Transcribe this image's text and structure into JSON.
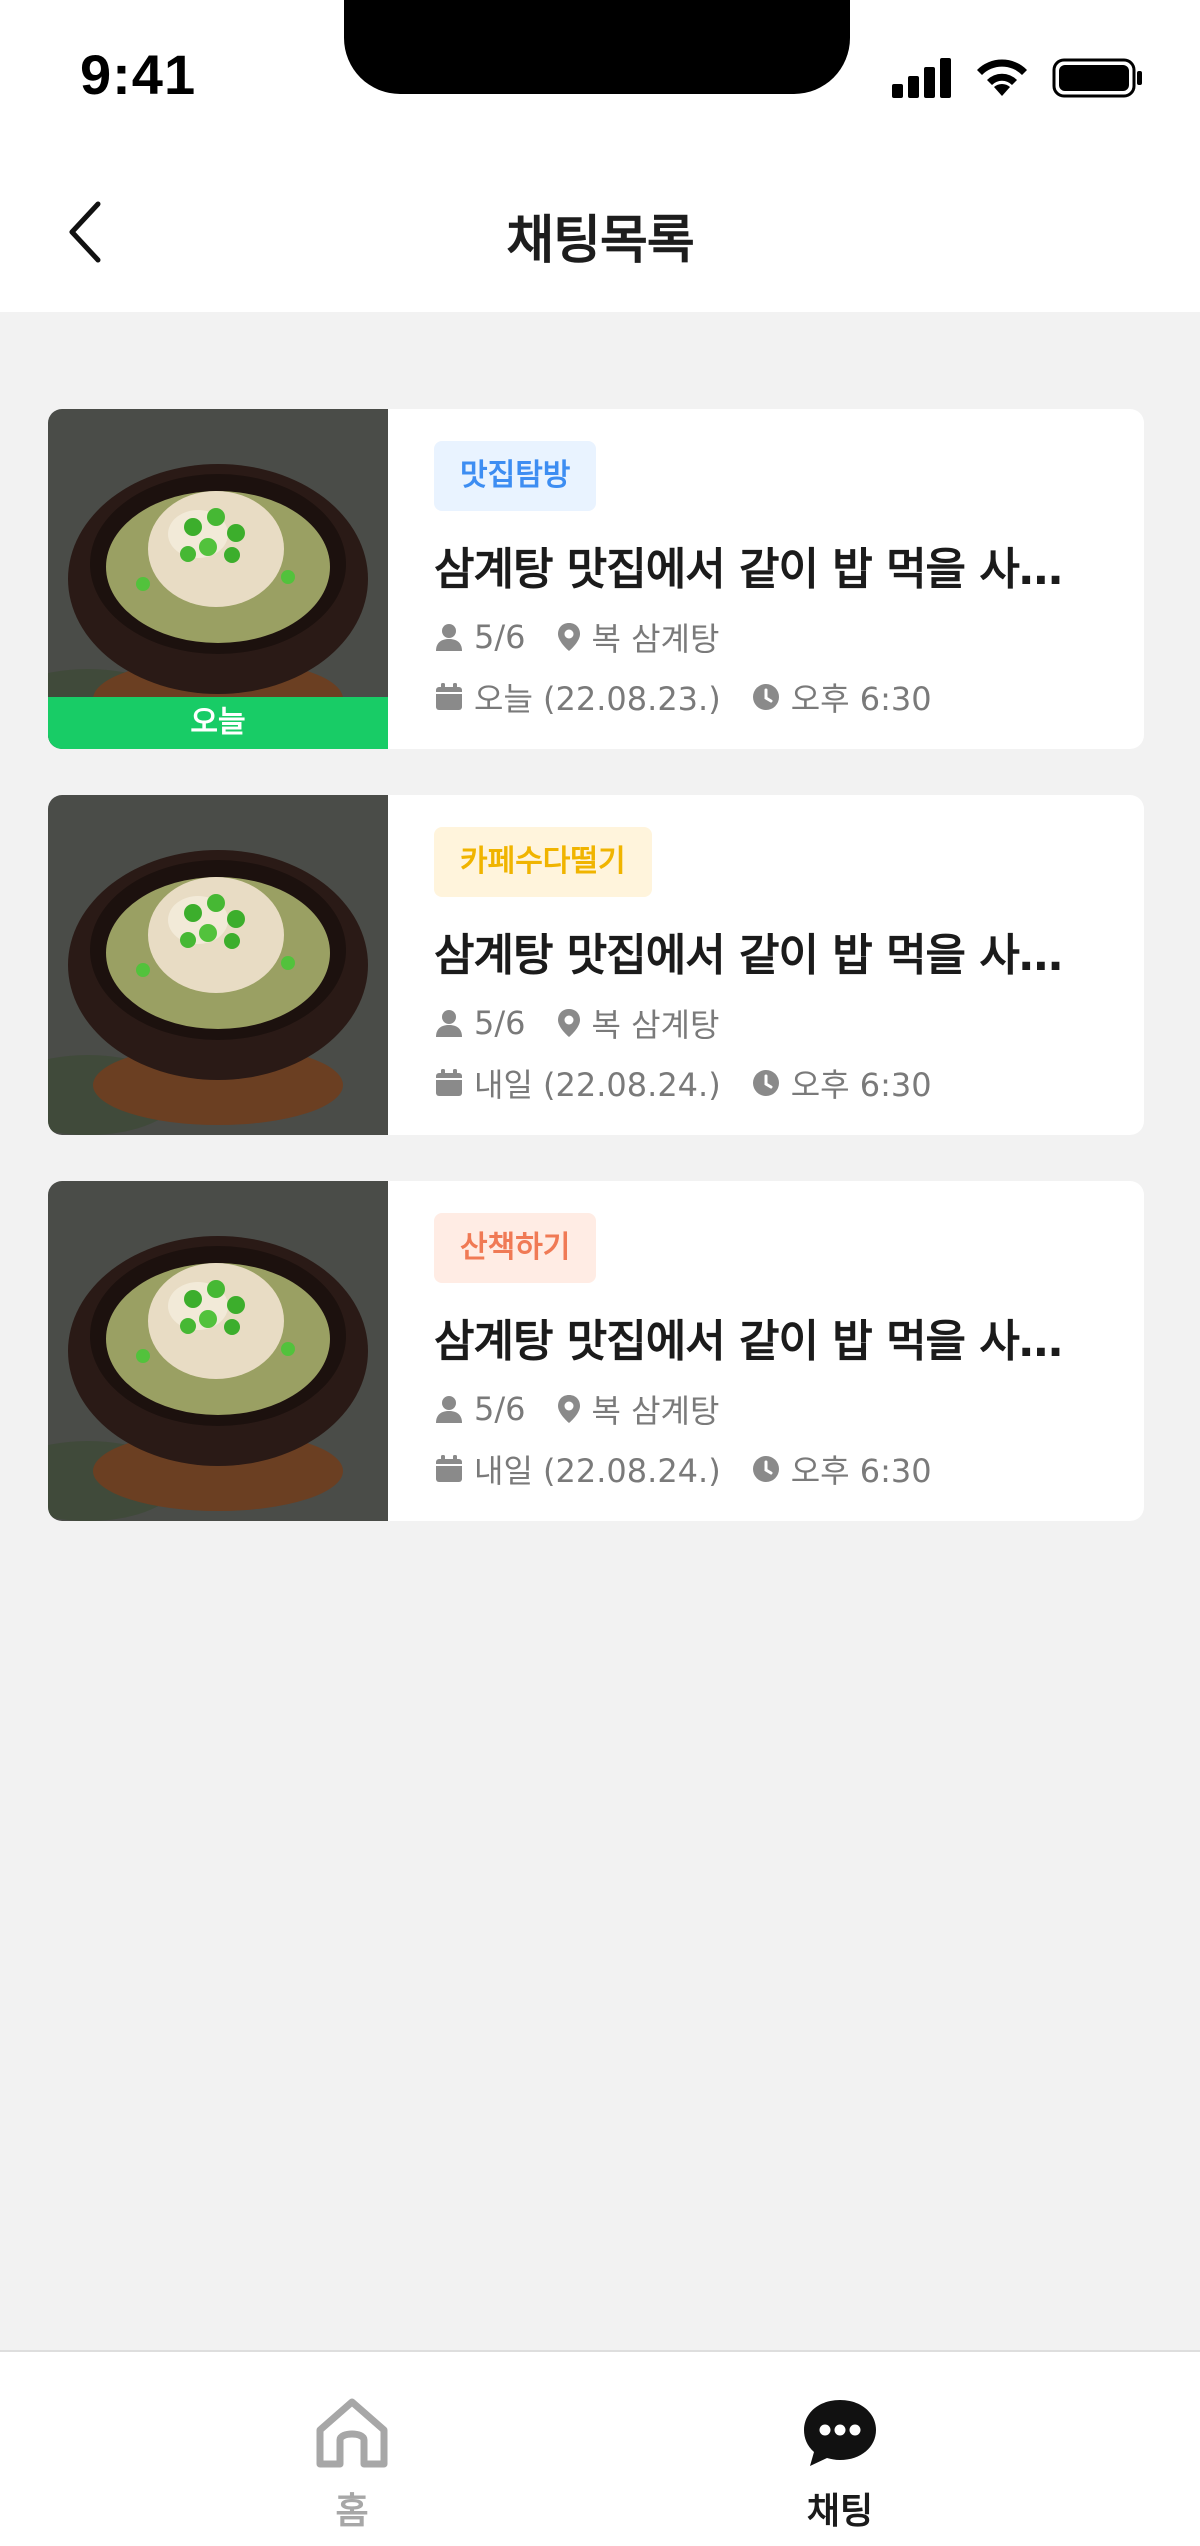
{
  "status_bar": {
    "time": "9:41",
    "icons": [
      "cellular-signal-icon",
      "wifi-icon",
      "battery-icon"
    ]
  },
  "header": {
    "title": "채팅목록",
    "back_icon": "chevron-left-icon"
  },
  "chat_list": [
    {
      "badge": "오늘",
      "tag": "맛집탐방",
      "tag_color": "#3d8df2",
      "title": "삼계탕 맛집에서 같이 밥 먹을 사…",
      "members": "5/6",
      "place": "복 삼계탕",
      "date": "오늘 (22.08.23.)",
      "time": "오후 6:30"
    },
    {
      "tag": "카페수다떨기",
      "tag_color": "#f0b400",
      "title": "삼계탕 맛집에서 같이 밥 먹을 사…",
      "members": "5/6",
      "place": "복 삼계탕",
      "date": "내일 (22.08.24.)",
      "time": "오후 6:30"
    },
    {
      "tag": "산책하기",
      "tag_color": "#f07a55",
      "title": "삼계탕 맛집에서 같이 밥 먹을 사…",
      "members": "5/6",
      "place": "복 삼계탕",
      "date": "내일 (22.08.24.)",
      "time": "오후 6:30"
    }
  ],
  "tab_bar": {
    "tabs": [
      {
        "label": "홈",
        "icon": "home-icon",
        "active": false
      },
      {
        "label": "채팅",
        "icon": "chat-bubble-icon",
        "active": true
      }
    ]
  },
  "colors": {
    "today_badge": "#18cc66",
    "background": "#f2f2f2",
    "meta_text": "#7a7a7a"
  }
}
